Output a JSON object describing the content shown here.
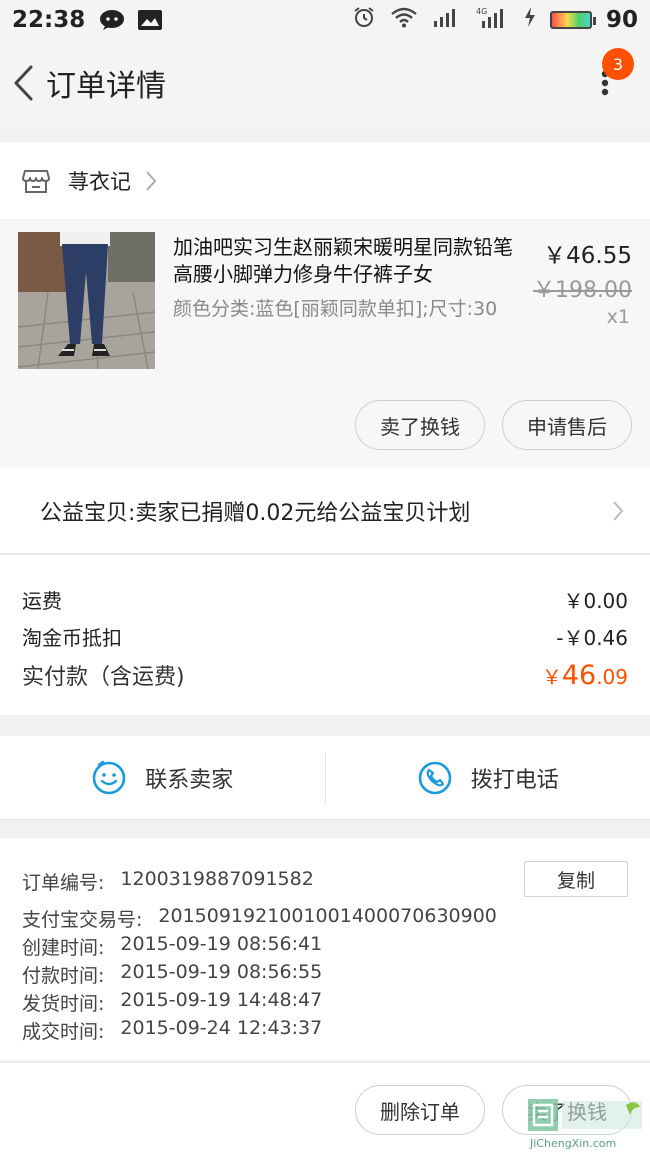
{
  "status_bar": {
    "time": "22:38",
    "battery_level": "90"
  },
  "nav": {
    "title": "订单详情",
    "badge_count": "3"
  },
  "shop": {
    "name": "荨衣记"
  },
  "item": {
    "title": "加油吧实习生赵丽颖宋暖明星同款铅笔高腰小脚弹力修身牛仔裤子女",
    "spec": "颜色分类:蓝色[丽颖同款单扣];尺寸:30",
    "price": "￥46.55",
    "original_price": "￥198.00",
    "quantity": "x1",
    "buttons": {
      "sell": "卖了换钱",
      "after_sale": "申请售后"
    }
  },
  "charity": {
    "text": "公益宝贝:卖家已捐赠0.02元给公益宝贝计划"
  },
  "fees": {
    "shipping_label": "运费",
    "shipping_value": "￥0.00",
    "coin_label": "淘金币抵扣",
    "coin_value": "-￥0.46",
    "paid_label": "实付款（含运费)",
    "paid_currency": "￥",
    "paid_integer": "46",
    "paid_decimal": ".09"
  },
  "contact": {
    "seller": "联系卖家",
    "phone": "拨打电话"
  },
  "order_info": {
    "copy_label": "复制",
    "rows": [
      {
        "label": "订单编号:",
        "value": "1200319887091582"
      },
      {
        "label": "支付宝交易号:",
        "value": "2015091921001001400070630900"
      },
      {
        "label": "创建时间:",
        "value": "2015-09-19 08:56:41"
      },
      {
        "label": "付款时间:",
        "value": "2015-09-19 08:56:55"
      },
      {
        "label": "发货时间:",
        "value": "2015-09-19 14:48:47"
      },
      {
        "label": "成交时间:",
        "value": "2015-09-24 12:43:37"
      }
    ]
  },
  "bottom": {
    "delete": "删除订单",
    "sell": "卖了换钱"
  },
  "watermark": {
    "text": "JiChengXin.com"
  },
  "colors": {
    "accent": "#ff5000",
    "contact_icon": "#1a9bdb"
  }
}
